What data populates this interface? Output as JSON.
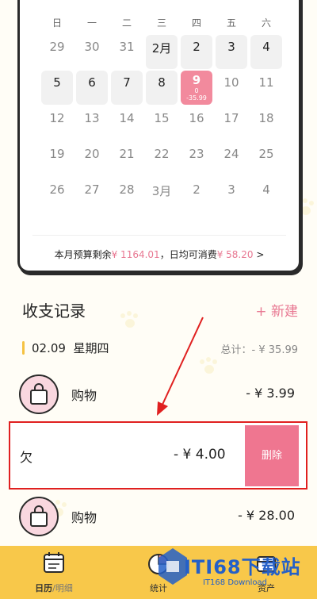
{
  "calendar": {
    "weekdays": [
      "日",
      "一",
      "二",
      "三",
      "四",
      "五",
      "六"
    ],
    "cells": [
      {
        "label": "29",
        "cur": false
      },
      {
        "label": "30",
        "cur": false
      },
      {
        "label": "31",
        "cur": false
      },
      {
        "label": "2月",
        "cur": true
      },
      {
        "label": "2",
        "cur": true
      },
      {
        "label": "3",
        "cur": true
      },
      {
        "label": "4",
        "cur": true
      },
      {
        "label": "5",
        "cur": true
      },
      {
        "label": "6",
        "cur": true
      },
      {
        "label": "7",
        "cur": true
      },
      {
        "label": "8",
        "cur": true
      },
      {
        "label": "9",
        "cur": true,
        "today": true,
        "sub1": "0",
        "sub2": "-35.99"
      },
      {
        "label": "10",
        "cur": false
      },
      {
        "label": "11",
        "cur": false
      },
      {
        "label": "12",
        "cur": false
      },
      {
        "label": "13",
        "cur": false
      },
      {
        "label": "14",
        "cur": false
      },
      {
        "label": "15",
        "cur": false
      },
      {
        "label": "16",
        "cur": false
      },
      {
        "label": "17",
        "cur": false
      },
      {
        "label": "18",
        "cur": false
      },
      {
        "label": "19",
        "cur": false
      },
      {
        "label": "20",
        "cur": false
      },
      {
        "label": "21",
        "cur": false
      },
      {
        "label": "22",
        "cur": false
      },
      {
        "label": "23",
        "cur": false
      },
      {
        "label": "24",
        "cur": false
      },
      {
        "label": "25",
        "cur": false
      },
      {
        "label": "26",
        "cur": false
      },
      {
        "label": "27",
        "cur": false
      },
      {
        "label": "28",
        "cur": false
      },
      {
        "label": "3月",
        "cur": false
      },
      {
        "label": "2",
        "cur": false
      },
      {
        "label": "3",
        "cur": false
      },
      {
        "label": "4",
        "cur": false
      }
    ],
    "budget_prefix": "本月预算剩余",
    "budget_value": "¥ 1164.01",
    "daily_prefix": "，日均可消费",
    "daily_value": "¥ 58.20",
    "budget_arrow": ">"
  },
  "records": {
    "title": "收支记录",
    "new_label": "+ 新建",
    "date": "02.09",
    "weekday": "星期四",
    "total": "总计：- ¥ 35.99",
    "items": [
      {
        "name": "购物",
        "amount": "- ¥ 3.99"
      },
      {
        "name": "购物",
        "amount": "- ¥ 28.00"
      }
    ],
    "swiped": {
      "name": "欠",
      "amount": "- ¥ 4.00",
      "delete_label": "删除"
    }
  },
  "nav": {
    "calendar_label": "日历",
    "detail_label": "/明细",
    "stats_label": "统计",
    "assets_label": "资产"
  },
  "watermark": {
    "text": "ITI68下载站",
    "sub": "IT168 Download"
  },
  "colors": {
    "accent": "#e87892",
    "nav": "#f8c84a",
    "delete": "#ef7690",
    "highlight": "#e02020"
  }
}
